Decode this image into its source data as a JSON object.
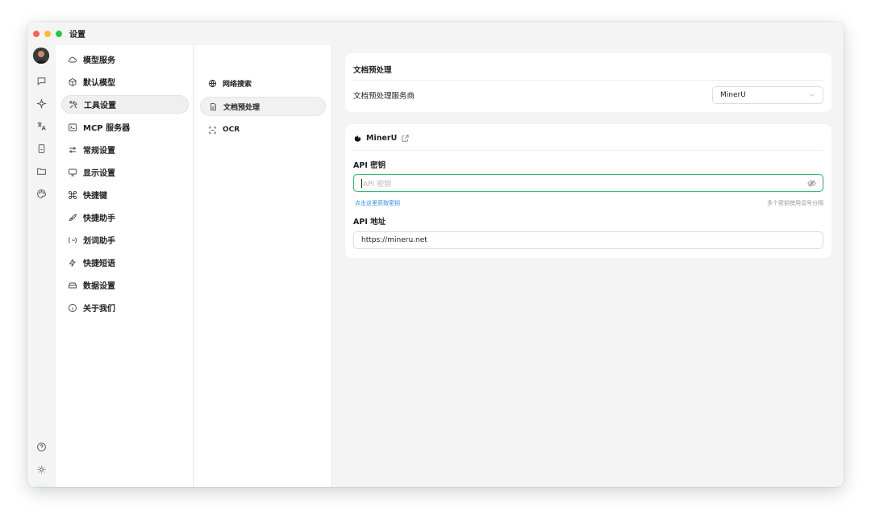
{
  "window": {
    "title": "设置"
  },
  "traffic_lights": {
    "close": "#ff5f57",
    "minimize": "#febc2e",
    "maximize": "#28c840"
  },
  "icon_bar": {
    "top_icons": [
      "avatar",
      "chat-icon",
      "sparkle-icon",
      "translate-icon",
      "mobile-icon",
      "folder-icon",
      "palette-icon"
    ],
    "bottom_icons": [
      "help-icon",
      "brightness-icon",
      "settings-icon"
    ]
  },
  "settings_menu": {
    "items": [
      {
        "label": "模型服务",
        "icon": "cloud-icon"
      },
      {
        "label": "默认模型",
        "icon": "cube-icon"
      },
      {
        "label": "工具设置",
        "icon": "tools-icon",
        "active": true
      },
      {
        "label": "MCP 服务器",
        "icon": "terminal-icon"
      },
      {
        "label": "常规设置",
        "icon": "sliders-icon"
      },
      {
        "label": "显示设置",
        "icon": "monitor-icon"
      },
      {
        "label": "快捷键",
        "icon": "command-icon"
      },
      {
        "label": "快捷助手",
        "icon": "rocket-icon"
      },
      {
        "label": "划词助手",
        "icon": "text-select-icon"
      },
      {
        "label": "快捷短语",
        "icon": "zap-icon"
      },
      {
        "label": "数据设置",
        "icon": "hard-drive-icon"
      },
      {
        "label": "关于我们",
        "icon": "info-icon"
      }
    ]
  },
  "tools_menu": {
    "items": [
      {
        "label": "网络搜索",
        "icon": "globe-icon"
      },
      {
        "label": "文档预处理",
        "icon": "file-icon",
        "active": true
      },
      {
        "label": "OCR",
        "icon": "scan-icon"
      }
    ]
  },
  "preprocess_card": {
    "title": "文档预处理",
    "provider_label": "文档预处理服务商",
    "provider_value": "MinerU"
  },
  "provider_card": {
    "name": "MinerU",
    "api_key_label": "API 密钥",
    "api_key_placeholder": "API 密钥",
    "get_key_link": "点击这里获取密钥",
    "multi_key_hint": "多个密钥使用逗号分隔",
    "api_host_label": "API 地址",
    "api_host_value": "https://mineru.net"
  },
  "colors": {
    "accent": "#3bb873",
    "link": "#2f8de4"
  }
}
